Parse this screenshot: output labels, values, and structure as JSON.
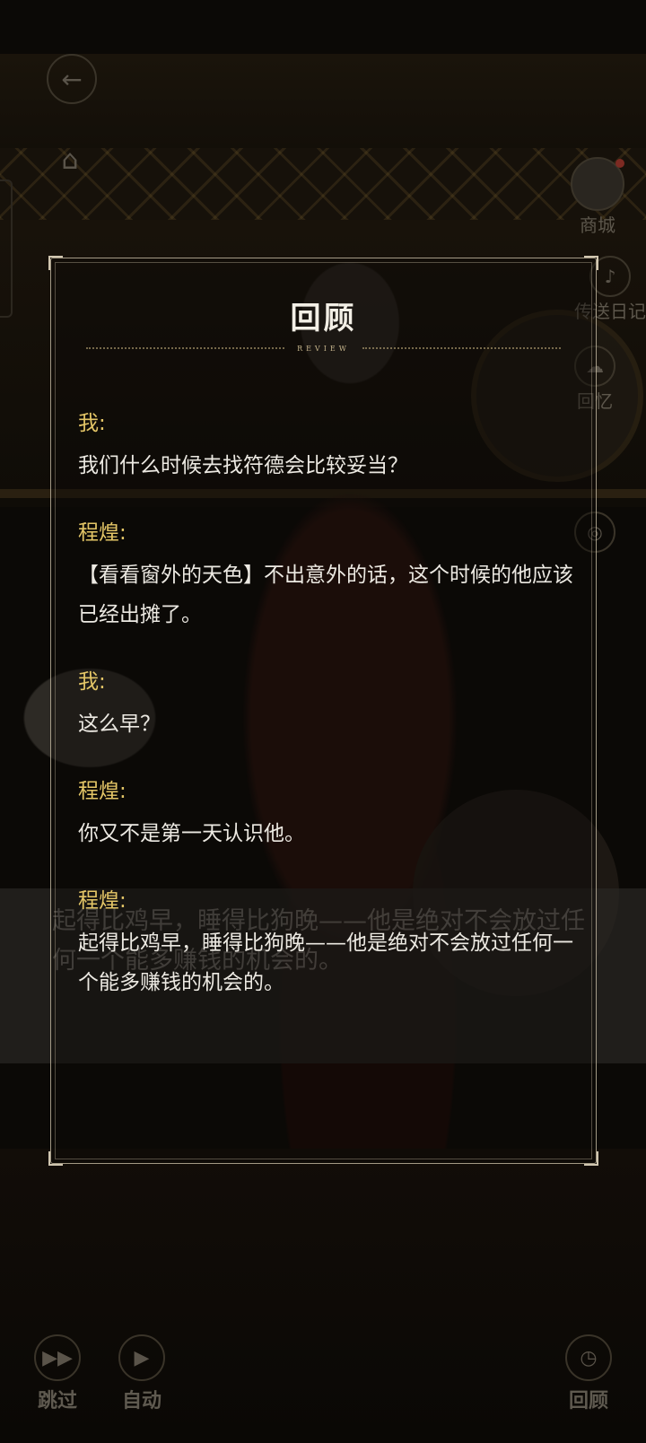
{
  "background": {
    "dialog_text": "起得比鸡早，睡得比狗晚——他是绝对不会放过任何一个能多赚钱的机会的。"
  },
  "hud": {
    "shop_label": "商城",
    "right_label_2": "传送日记",
    "right_label_3": "回忆",
    "skip_label": "跳过",
    "auto_label": "自动",
    "review_label": "回顾"
  },
  "panel": {
    "title": "回顾",
    "subtitle": "REVIEW",
    "entries": [
      {
        "speaker": "我:",
        "text": "我们什么时候去找符德会比较妥当？"
      },
      {
        "speaker": "程煌:",
        "text": "【看看窗外的天色】不出意外的话，这个时候的他应该已经出摊了。"
      },
      {
        "speaker": "我:",
        "text": "这么早？"
      },
      {
        "speaker": "程煌:",
        "text": "你又不是第一天认识他。"
      },
      {
        "speaker": "程煌:",
        "text": "起得比鸡早，睡得比狗晚——他是绝对不会放过任何一个能多赚钱的机会的。"
      }
    ]
  },
  "colors": {
    "speaker": "#e4c667",
    "text": "#ece9e2",
    "frame": "#d6c9b0"
  }
}
